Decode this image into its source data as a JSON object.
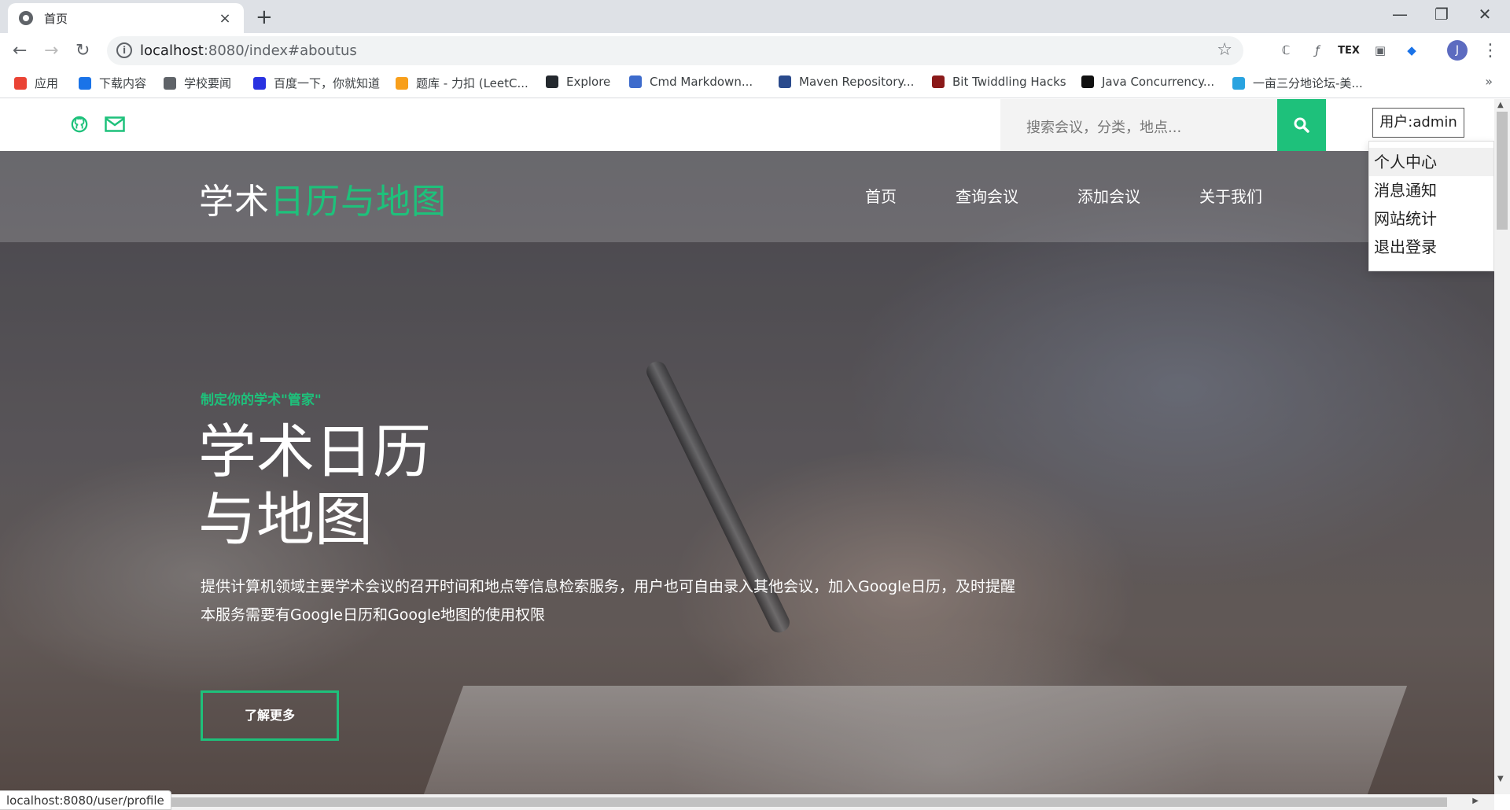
{
  "browser": {
    "tab_title": "首页",
    "tab_close": "×",
    "new_tab": "+",
    "window": {
      "minimize": "—",
      "restore": "❐",
      "close": "✕"
    },
    "nav": {
      "back": "←",
      "forward": "→",
      "reload": "↻"
    },
    "url_host": "localhost",
    "url_path": ":8080/index#aboutus",
    "star": "☆",
    "extensions": [
      "ℂ",
      "ƒ",
      "TEX",
      "▣",
      "◆"
    ],
    "avatar": "J",
    "menu": "⋮",
    "bookmarks": [
      {
        "label": "应用",
        "icon": "apps-icon",
        "color": "#ea4335"
      },
      {
        "label": "下载内容",
        "icon": "download-icon",
        "color": "#1a73e8"
      },
      {
        "label": "学校要闻",
        "icon": "globe-icon",
        "color": "#5f6368"
      },
      {
        "label": "百度一下，你就知道",
        "icon": "baidu-icon",
        "color": "#2932e1"
      },
      {
        "label": "题库 - 力扣 (LeetC...",
        "icon": "leetcode-icon",
        "color": "#f89f1b"
      },
      {
        "label": "Explore",
        "icon": "github-icon",
        "color": "#24292e"
      },
      {
        "label": "Cmd Markdown...",
        "icon": "cmd-icon",
        "color": "#3d6bcc"
      },
      {
        "label": "Maven Repository...",
        "icon": "maven-icon",
        "color": "#2a4a8c"
      },
      {
        "label": "Bit Twiddling Hacks",
        "icon": "bithacks-icon",
        "color": "#8b1a1a"
      },
      {
        "label": "Java Concurrency...",
        "icon": "java-icon",
        "color": "#111111"
      },
      {
        "label": "一亩三分地论坛-美...",
        "icon": "forum-icon",
        "color": "#29a3e0"
      }
    ],
    "bookmarks_more": "»",
    "status_url": "localhost:8080/user/profile"
  },
  "site": {
    "search_placeholder": "搜索会议，分类，地点...",
    "user_button": "用户:admin",
    "user_menu": [
      "个人中心",
      "消息通知",
      "网站统计",
      "退出登录"
    ],
    "logo_white": "学术",
    "logo_green": "日历与地图",
    "nav": [
      "首页",
      "查询会议",
      "添加会议",
      "关于我们"
    ],
    "eyebrow": "制定你的学术\"管家\"",
    "title_line1": "学术日历",
    "title_line2": "与地图",
    "desc_line1": "提供计算机领域主要学术会议的召开时间和地点等信息检索服务，用户也可自由录入其他会议，加入Google日历，及时提醒",
    "desc_line2": "本服务需要有Google日历和Google地图的使用权限",
    "learn_more": "了解更多",
    "accent_color": "#1ec17b"
  }
}
